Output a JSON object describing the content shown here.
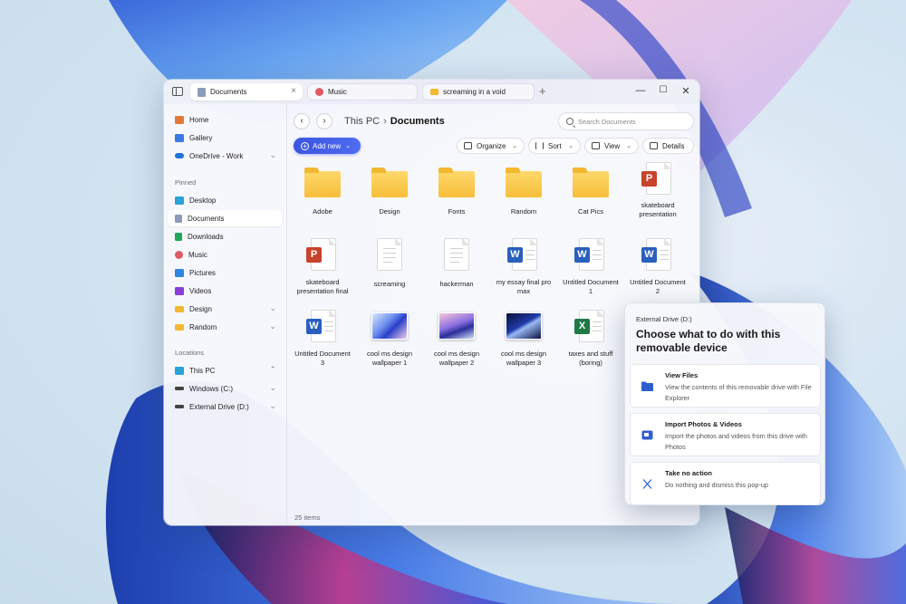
{
  "window": {
    "tabs": [
      {
        "label": "Documents",
        "active": true,
        "color": "#8b9bb8"
      },
      {
        "label": "Music",
        "active": false,
        "color": "#e05a66"
      },
      {
        "label": "screaming in a void",
        "active": false,
        "color": "#f2b82f"
      }
    ],
    "tab_close": "×",
    "tab_add": "+",
    "controls": {
      "minimize": "—",
      "maximize": "☐",
      "close": "✕"
    }
  },
  "sidebar": {
    "top_items": [
      {
        "label": "Home",
        "icon": "home-icon",
        "color": "#e07a3a"
      },
      {
        "label": "Gallery",
        "icon": "gallery-icon",
        "color": "#3b7be0"
      },
      {
        "label": "OneDrive - Work",
        "icon": "cloud-icon",
        "color": "#1f73d6",
        "chevron": "⌄"
      }
    ],
    "pinned_label": "Pinned",
    "pinned": [
      {
        "label": "Desktop",
        "icon": "desktop-icon",
        "color": "#2aa3d8"
      },
      {
        "label": "Documents",
        "icon": "documents-icon",
        "color": "#8b9bb8",
        "selected": true
      },
      {
        "label": "Downloads",
        "icon": "download-icon",
        "color": "#23a55a"
      },
      {
        "label": "Music",
        "icon": "music-icon",
        "color": "#e05a66"
      },
      {
        "label": "Pictures",
        "icon": "pictures-icon",
        "color": "#2f86e0"
      },
      {
        "label": "Videos",
        "icon": "videos-icon",
        "color": "#8a3fd6"
      },
      {
        "label": "Design",
        "icon": "folder-icon",
        "color": "#f2b82f",
        "chevron": "⌄"
      },
      {
        "label": "Random",
        "icon": "folder-icon",
        "color": "#f2b82f",
        "chevron": "⌄"
      }
    ],
    "locations_label": "Locations",
    "locations": [
      {
        "label": "This PC",
        "icon": "pc-icon",
        "color": "#2aa3d8",
        "chevron": "⌃"
      },
      {
        "label": "Windows (C:)",
        "icon": "drive-icon",
        "color": "#444444",
        "chevron": "⌄"
      },
      {
        "label": "External Drive (D:)",
        "icon": "drive-icon",
        "color": "#444444",
        "chevron": "⌄"
      }
    ]
  },
  "main": {
    "back": "‹",
    "forward": "›",
    "breadcrumb": {
      "root": "This PC",
      "sep": "›",
      "current": "Documents"
    },
    "search_placeholder": "Search Documents",
    "add_new": {
      "label": "Add new",
      "plus": "+",
      "dropdown": "⌄"
    },
    "toolbar": [
      {
        "label": "Organize",
        "icon": "organize-icon",
        "dropdown": "⌄"
      },
      {
        "label": "Sort",
        "icon": "sort-icon",
        "dropdown": "⌄"
      },
      {
        "label": "View",
        "icon": "view-icon",
        "dropdown": "⌄"
      },
      {
        "label": "Details",
        "icon": "details-icon"
      }
    ],
    "items": [
      {
        "label": "Adobe",
        "type": "folder"
      },
      {
        "label": "Design",
        "type": "folder"
      },
      {
        "label": "Fonts",
        "type": "folder"
      },
      {
        "label": "Random",
        "type": "folder"
      },
      {
        "label": "Cat Pics",
        "type": "folder"
      },
      {
        "label": "skateboard presentation",
        "type": "ppt",
        "badge": "P",
        "color": "#c8432b"
      },
      {
        "label": "skateboard presentation final",
        "type": "ppt",
        "badge": "P",
        "color": "#c8432b"
      },
      {
        "label": "screaming",
        "type": "txt"
      },
      {
        "label": "hackerman",
        "type": "txt"
      },
      {
        "label": "my essay final pro max",
        "type": "word",
        "badge": "W",
        "color": "#2b5fbd"
      },
      {
        "label": "Untitled Document 1",
        "type": "word",
        "badge": "W",
        "color": "#2b5fbd"
      },
      {
        "label": "Untitled Document 2",
        "type": "word",
        "badge": "W",
        "color": "#2b5fbd"
      },
      {
        "label": "Untitled Document 3",
        "type": "word",
        "badge": "W",
        "color": "#2b5fbd"
      },
      {
        "label": "cool ms design wallpaper 1",
        "type": "image",
        "theme": "blue"
      },
      {
        "label": "cool ms design wallpaper 2",
        "type": "image",
        "theme": "purple"
      },
      {
        "label": "cool ms design wallpaper 3",
        "type": "image",
        "theme": "dark"
      },
      {
        "label": "taxes and stuff (boring)",
        "type": "excel",
        "badge": "X",
        "color": "#1f7a45"
      }
    ],
    "status": "25 items"
  },
  "popup": {
    "subtitle": "External Drive (D:)",
    "title": "Choose what to do with this removable device",
    "options": [
      {
        "title": "View Files",
        "desc": "View the contents of this removable drive with File Explorer",
        "icon": "folder-icon"
      },
      {
        "title": "Import Photos & Videos",
        "desc": "Import the photos and videos from this drive with Photos",
        "icon": "photos-icon"
      },
      {
        "title": "Take no action",
        "desc": "Do nothing and dismiss this pop-up",
        "icon": "close-icon"
      }
    ]
  }
}
